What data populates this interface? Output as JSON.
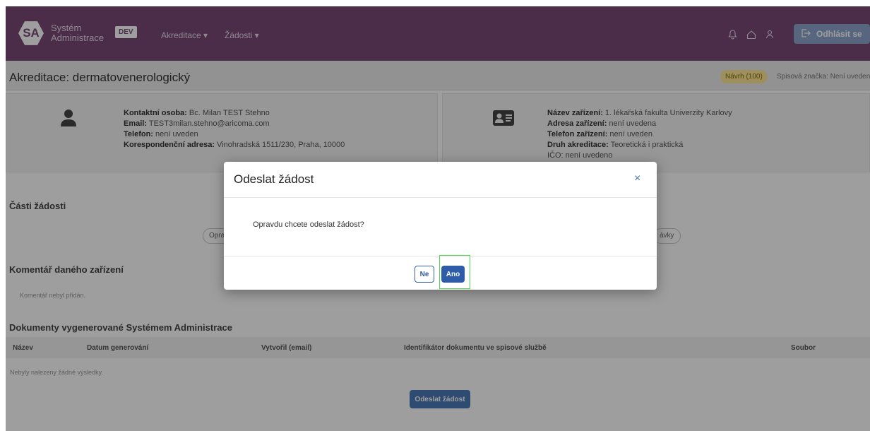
{
  "navbar": {
    "logo_text": "SA",
    "brand_line1": "Systém",
    "brand_line2": "Administrace",
    "env_badge": "DEV",
    "menu": [
      {
        "label": "Akreditace ▾"
      },
      {
        "label": "Žádosti ▾"
      }
    ],
    "icons": [
      "bell-icon",
      "home-icon",
      "user-icon"
    ],
    "logout_label": "Odhlásit se"
  },
  "page": {
    "title": "Akreditace: dermatovenerologický",
    "status_badge": "Návrh (100)",
    "spisova_znacka": "Spisová značka: Není uvedena"
  },
  "contact": {
    "person_label": "Kontaktní osoba:",
    "person_value": " Bc. Milan TEST Stehno",
    "email_label": "Email:",
    "email_value": " TEST3milan.stehno@aricoma.com",
    "phone_label": "Telefon:",
    "phone_value": " není uveden",
    "address_label": "Korespondenční adresa:",
    "address_value": " Vinohradská 1511/230, Praha, 10000"
  },
  "facility": {
    "name_label": "Název zařízení:",
    "name_value": " 1. lékařská fakulta Univerzity Karlovy",
    "address_label": "Adresa zařízení:",
    "address_value": " není uvedena",
    "phone_label": "Telefon zařízení:",
    "phone_value": " není uveden",
    "type_label": "Druh akreditace:",
    "type_value": " Teoretická i praktická",
    "ico_partial": "IČO: není uvedeno"
  },
  "sections": {
    "parts_title": "Části žádosti",
    "parts_pill_left": "Opra",
    "parts_pill_right": "ávky",
    "comment_title": "Komentář daného zařízení",
    "comment_empty": "Komentář nebyl přidán.",
    "docs_title": "Dokumenty vygenerované Systémem Administrace"
  },
  "docs_table": {
    "columns": [
      "Název",
      "Datum generování",
      "Vytvořil (email)",
      "Identifikátor dokumentu ve spisové službě",
      "Soubor"
    ],
    "empty_text": "Nebyly nalezeny žádné výsledky."
  },
  "send_button": "Odeslat žádost",
  "modal": {
    "title": "Odeslat žádost",
    "close": "×",
    "body": "Opravdu chcete odeslat žádost?",
    "no_label": "Ne",
    "yes_label": "Ano"
  },
  "colors": {
    "navbar": "#7a4a78",
    "primary": "#2e5ca8",
    "focus_outline": "#49e04a",
    "status_badge": "#ffe79a"
  }
}
